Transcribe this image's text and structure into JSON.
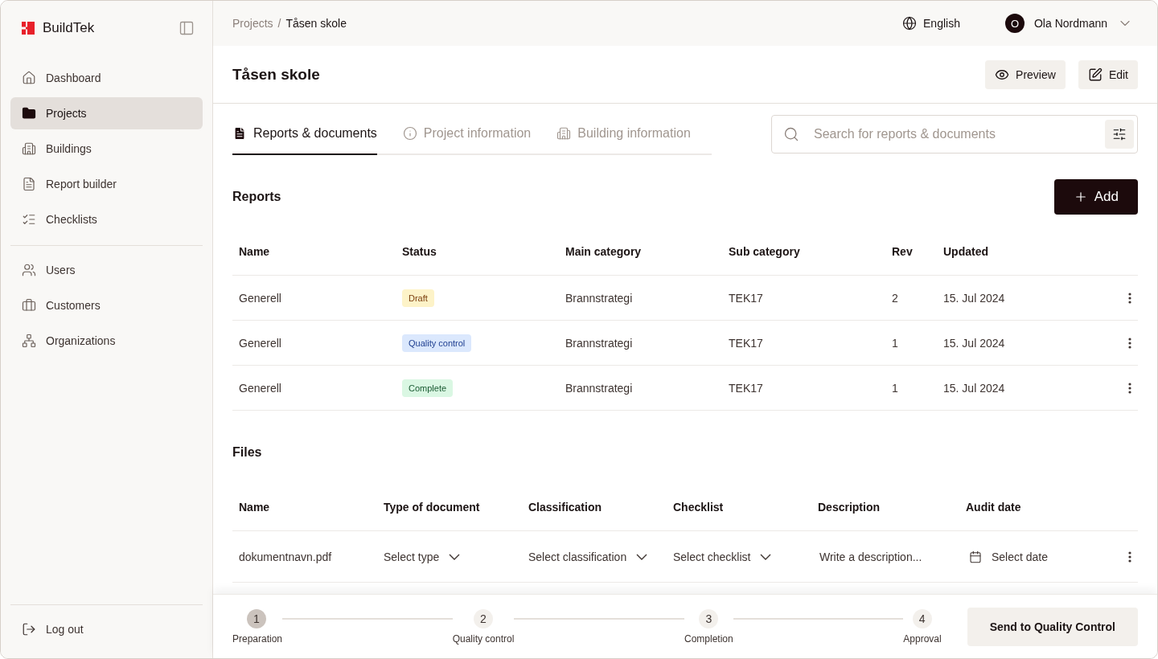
{
  "brand": {
    "name": "BuildTek"
  },
  "sidebar": {
    "groups": [
      [
        {
          "label": "Dashboard",
          "selected": false
        },
        {
          "label": "Projects",
          "selected": true
        },
        {
          "label": "Buildings",
          "selected": false
        },
        {
          "label": "Report builder",
          "selected": false
        },
        {
          "label": "Checklists",
          "selected": false
        }
      ],
      [
        {
          "label": "Users",
          "selected": false
        },
        {
          "label": "Customers",
          "selected": false
        },
        {
          "label": "Organizations",
          "selected": false
        }
      ]
    ],
    "logout": "Log out"
  },
  "breadcrumb": [
    "Projects",
    "Tåsen skole"
  ],
  "breadcrumb_separator": "/",
  "language": "English",
  "user": {
    "initial": "O",
    "name": "Ola Nordmann"
  },
  "page": {
    "title": "Tåsen skole",
    "actions": [
      "Preview",
      "Edit"
    ]
  },
  "tabs": [
    {
      "label": "Reports & documents",
      "selected": true
    },
    {
      "label": "Project information",
      "selected": false
    },
    {
      "label": "Building information",
      "selected": false
    }
  ],
  "search": {
    "placeholder": "Search for reports & documents"
  },
  "reports": {
    "title": "Reports",
    "add_button": "Add",
    "columns": [
      "Name",
      "Status",
      "Main category",
      "Sub category",
      "Rev",
      "Updated"
    ],
    "rows": [
      {
        "name": "Generell",
        "status": {
          "label": "Draft",
          "kind": "draft"
        },
        "main": "Brannstrategi",
        "sub": "TEK17",
        "rev": "2",
        "updated": "15. Jul 2024"
      },
      {
        "name": "Generell",
        "status": {
          "label": "Quality control",
          "kind": "qc"
        },
        "main": "Brannstrategi",
        "sub": "TEK17",
        "rev": "1",
        "updated": "15. Jul 2024"
      },
      {
        "name": "Generell",
        "status": {
          "label": "Complete",
          "kind": "complete"
        },
        "main": "Brannstrategi",
        "sub": "TEK17",
        "rev": "1",
        "updated": "15. Jul 2024"
      }
    ]
  },
  "files": {
    "title": "Files",
    "columns": [
      "Name",
      "Type of document",
      "Classification",
      "Checklist",
      "Description",
      "Audit date"
    ],
    "rows": [
      {
        "name": "dokumentnavn.pdf",
        "type": {
          "placeholder": "Select type"
        },
        "classification": {
          "placeholder": "Select classification"
        },
        "checklist": {
          "placeholder": "Select checklist"
        },
        "description": {
          "placeholder": "Write a description..."
        },
        "audit_date": {
          "placeholder": "Select date"
        }
      }
    ]
  },
  "stepper": {
    "steps": [
      {
        "number": "1",
        "label": "Preparation",
        "selected": true
      },
      {
        "number": "2",
        "label": "Quality control",
        "selected": false
      },
      {
        "number": "3",
        "label": "Completion",
        "selected": false
      },
      {
        "number": "4",
        "label": "Approval",
        "selected": false
      }
    ],
    "submit": "Send to Quality Control"
  }
}
